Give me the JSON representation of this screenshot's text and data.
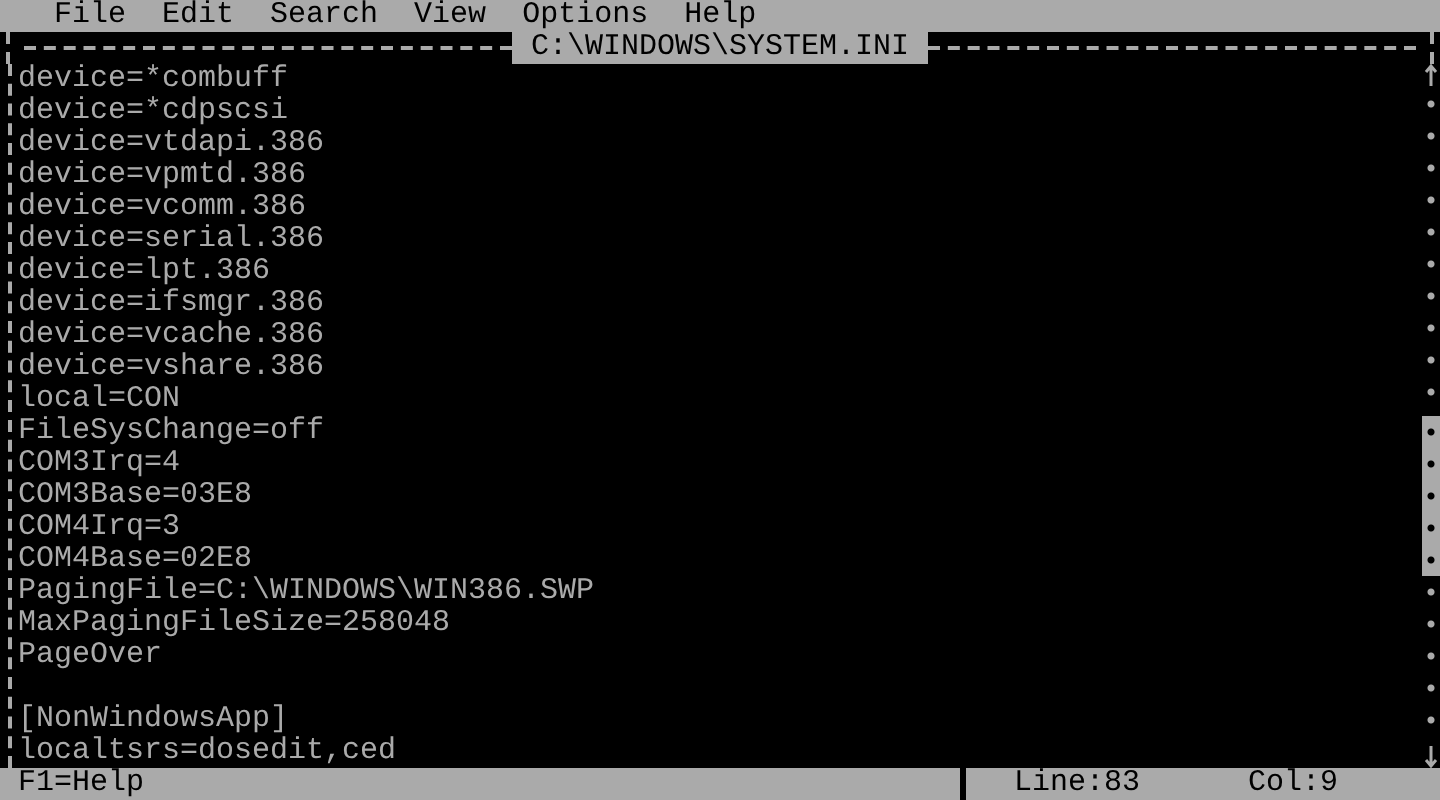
{
  "menu_bar": [
    "File",
    "Edit",
    "Search",
    "View",
    "Options",
    "Help"
  ],
  "window": {
    "title": "C:\\WINDOWS\\SYSTEM.INI"
  },
  "lines": [
    {
      "kind": "text",
      "text": "device=*combuff"
    },
    {
      "kind": "text",
      "text": "device=*cdpscsi"
    },
    {
      "kind": "text",
      "text": "device=vtdapi.386"
    },
    {
      "kind": "text",
      "text": "device=vpmtd.386"
    },
    {
      "kind": "text",
      "text": "device=vcomm.386"
    },
    {
      "kind": "text",
      "text": "device=serial.386"
    },
    {
      "kind": "text",
      "text": "device=lpt.386"
    },
    {
      "kind": "text",
      "text": "device=ifsmgr.386"
    },
    {
      "kind": "text",
      "text": "device=vcache.386"
    },
    {
      "kind": "text",
      "text": "device=vshare.386"
    },
    {
      "kind": "text",
      "text": "local=CON"
    },
    {
      "kind": "text",
      "text": "FileSysChange=off"
    },
    {
      "kind": "text",
      "text": "COM3Irq=4"
    },
    {
      "kind": "text",
      "text": "COM3Base=03E8"
    },
    {
      "kind": "text",
      "text": "COM4Irq=3"
    },
    {
      "kind": "text",
      "text": "COM4Base=02E8"
    },
    {
      "kind": "text",
      "text": "PagingFile=C:\\WINDOWS\\WIN386.SWP"
    },
    {
      "kind": "text",
      "text": "MaxPagingFileSize=258048"
    },
    {
      "kind": "text",
      "text": "PageOver"
    },
    {
      "kind": "blank"
    },
    {
      "kind": "text",
      "text": "[NonWindowsApp]"
    },
    {
      "kind": "text",
      "text": "localtsrs=dosedit,ced"
    }
  ],
  "status_bar": {
    "help": "F1=Help",
    "line": "Line:83",
    "column": "Col:9"
  }
}
